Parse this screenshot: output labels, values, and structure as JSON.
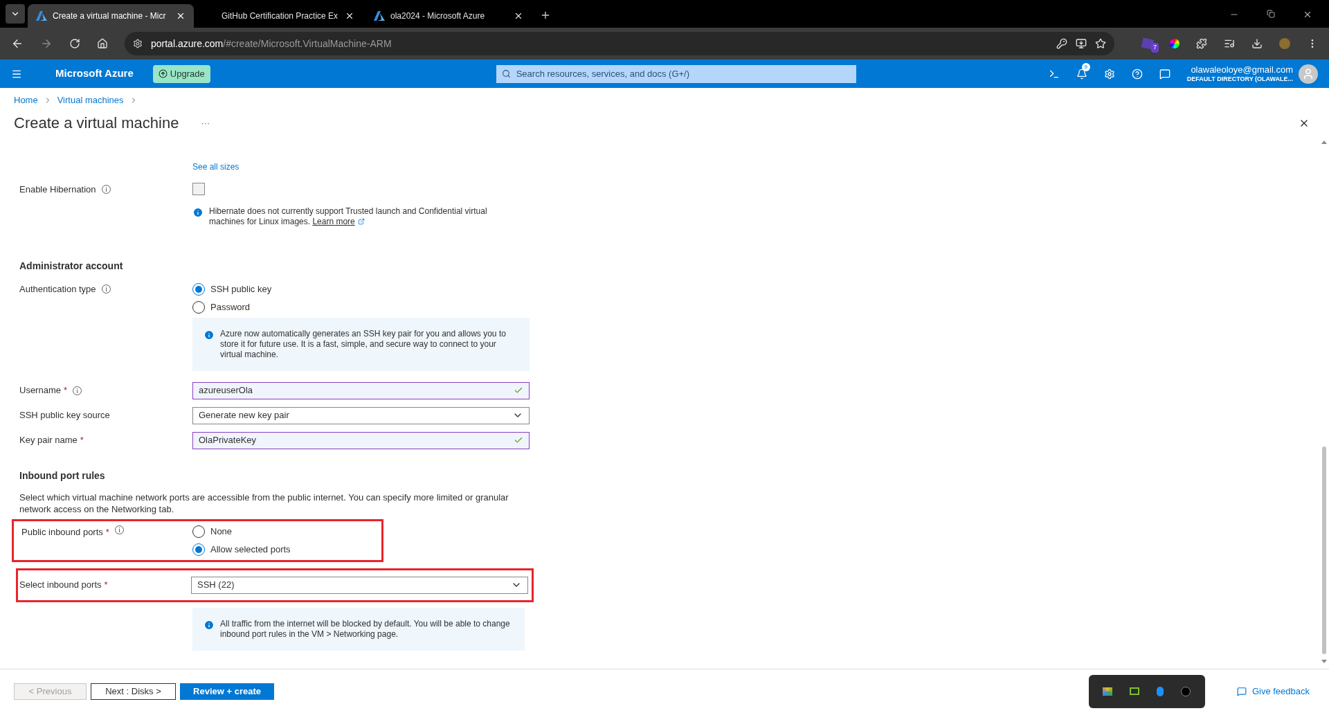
{
  "browser": {
    "tabs": [
      {
        "title": "Create a virtual machine - Micr",
        "selected": true,
        "azure": true
      },
      {
        "title": "GitHub Certification Practice Ex",
        "selected": false,
        "azure": false
      },
      {
        "title": "ola2024 - Microsoft Azure",
        "selected": false,
        "azure": true
      }
    ],
    "url_host": "portal.azure.com",
    "url_path": "/#create/Microsoft.VirtualMachine-ARM",
    "extension_badge": "7"
  },
  "portal": {
    "brand": "Microsoft Azure",
    "upgrade": "Upgrade",
    "search_placeholder": "Search resources, services, and docs (G+/)",
    "notification_count": "9",
    "account_email": "olawaleoloye@gmail.com",
    "account_directory": "DEFAULT DIRECTORY (OLAWALE..."
  },
  "breadcrumb": [
    "Home",
    "Virtual machines"
  ],
  "title": "Create a virtual machine",
  "more": "···",
  "see_all_sizes": "See all sizes",
  "hibernation": {
    "label": "Enable Hibernation",
    "checked": false,
    "note": "Hibernate does not currently support Trusted launch and Confidential virtual machines for Linux images.",
    "link": "Learn more"
  },
  "admin": {
    "heading": "Administrator account",
    "auth_label": "Authentication type",
    "options": [
      {
        "label": "SSH public key",
        "selected": true
      },
      {
        "label": "Password",
        "selected": false
      }
    ],
    "note": "Azure now automatically generates an SSH key pair for you and allows you to store it for future use. It is a fast, simple, and secure way to connect to your virtual machine."
  },
  "fields": [
    {
      "kind": "text",
      "label": "Username",
      "required_mark": "*",
      "info": true,
      "value": "azureuserOla",
      "valid": true
    },
    {
      "kind": "select",
      "label": "SSH public key source",
      "info": false,
      "value": "Generate new key pair",
      "valid": false
    },
    {
      "kind": "text",
      "label": "Key pair name",
      "required_mark": "*",
      "info": false,
      "value": "OlaPrivateKey",
      "valid": true
    }
  ],
  "inbound": {
    "heading": "Inbound port rules",
    "description": "Select which virtual machine network ports are accessible from the public internet. You can specify more limited or granular network access on the Networking tab.",
    "public_label": "Public inbound ports",
    "public_required_mark": "*",
    "public_highlighted": true,
    "options": [
      {
        "label": "None",
        "selected": false
      },
      {
        "label": "Allow selected ports",
        "selected": true
      }
    ],
    "select_label": "Select inbound ports",
    "select_required_mark": "*",
    "select_highlighted": true,
    "select_value": "SSH (22)",
    "note": "All traffic from the internet will be blocked by default. You will be able to change inbound port rules in the VM > Networking page."
  },
  "footer": {
    "previous": "< Previous",
    "previous_disabled": true,
    "next": "Next : Disks >",
    "review": "Review + create",
    "feedback": "Give feedback"
  }
}
